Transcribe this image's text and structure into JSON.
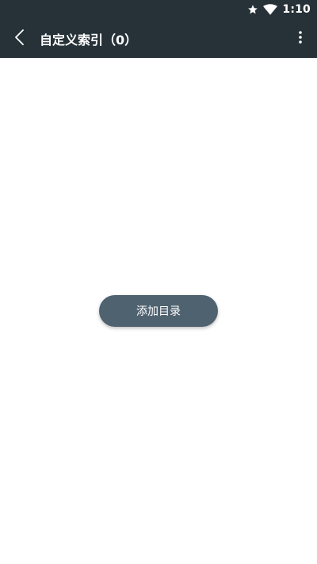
{
  "status_bar": {
    "time": "1:10",
    "icons": [
      "star-icon",
      "wifi-icon"
    ]
  },
  "app_bar": {
    "title": "自定义索引（0）",
    "back_icon": "chevron-left-icon",
    "overflow_icon": "more-vert-icon"
  },
  "main": {
    "add_directory_label": "添加目录"
  },
  "colors": {
    "bar_background": "#263238",
    "button_background": "#4f6270",
    "page_background": "#ffffff"
  }
}
